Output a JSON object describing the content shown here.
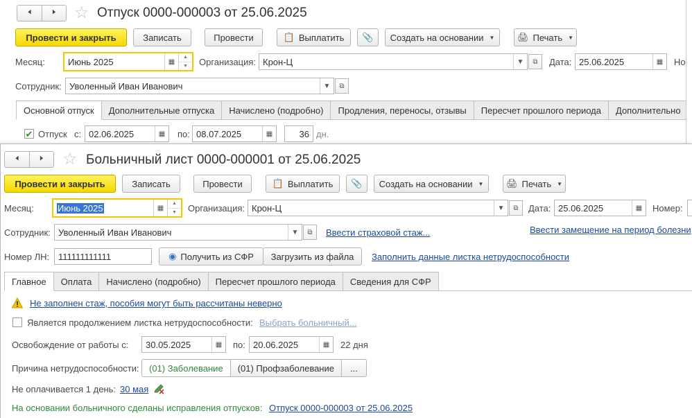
{
  "doc1": {
    "title": "Отпуск 0000-000003 от 25.06.2025",
    "toolbar": {
      "post_close": "Провести и закрыть",
      "save": "Записать",
      "post": "Провести",
      "pay": "Выплатить",
      "create_based": "Создать на основании",
      "print": "Печать"
    },
    "month_label": "Месяц:",
    "month_value": "Июнь 2025",
    "org_label": "Организация:",
    "org_value": "Крон-Ц",
    "date_label": "Дата:",
    "date_value": "25.06.2025",
    "number_label_cut": "Но",
    "employee_label": "Сотрудник:",
    "employee_value": "Уволенный Иван Иванович",
    "tabs": [
      "Основной отпуск",
      "Дополнительные отпуска",
      "Начислено (подробно)",
      "Продления, переносы, отзывы",
      "Пересчет прошлого периода",
      "Дополнительно"
    ],
    "vacation": {
      "checkbox_label": "Отпуск",
      "from_label": "с:",
      "from_value": "02.06.2025",
      "to_label": "по:",
      "to_value": "08.07.2025",
      "days_value": "36",
      "days_unit": "дн."
    }
  },
  "doc2": {
    "title": "Больничный лист 0000-000001 от 25.06.2025",
    "toolbar": {
      "post_close": "Провести и закрыть",
      "save": "Записать",
      "post": "Провести",
      "pay": "Выплатить",
      "create_based": "Создать на основании",
      "print": "Печать"
    },
    "month_label": "Месяц:",
    "month_value": "Июнь 2025",
    "org_label": "Организация:",
    "org_value": "Крон-Ц",
    "date_label": "Дата:",
    "date_value": "25.06.2025",
    "number_label": "Номер:",
    "employee_label": "Сотрудник:",
    "employee_value": "Уволенный Иван Иванович",
    "insurance_link": "Ввести страховой стаж...",
    "replacement_link": "Ввести замещение на период болезни",
    "ln_label": "Номер ЛН:",
    "ln_value": "111111111111",
    "get_sfr": "Получить из СФР",
    "load_file": "Загрузить из файла",
    "fill_link": "Заполнить данные листка нетрудоспособности",
    "tabs": [
      "Главное",
      "Оплата",
      "Начислено (подробно)",
      "Пересчет прошлого периода",
      "Сведения для СФР"
    ],
    "warning_link": "Не заполнен стаж, пособия могут быть рассчитаны неверно",
    "continuation_label": "Является продолжением листка нетрудоспособности:",
    "choose_link": "Выбрать больничный...",
    "release_label": "Освобождение от работы с:",
    "release_from": "30.05.2025",
    "release_to_label": "по:",
    "release_to": "20.06.2025",
    "release_days": "22 дня",
    "reason_label": "Причина нетрудоспособности:",
    "reason_options": [
      "(01) Заболевание",
      "(01) Профзаболевание",
      "..."
    ],
    "unpaid_label": "Не оплачивается 1 день:",
    "unpaid_link": "30 мая",
    "corrections_label": "На основании больничного сделаны исправления отпусков:",
    "corrections_link": "Отпуск 0000-000003 от 25.06.2025"
  }
}
